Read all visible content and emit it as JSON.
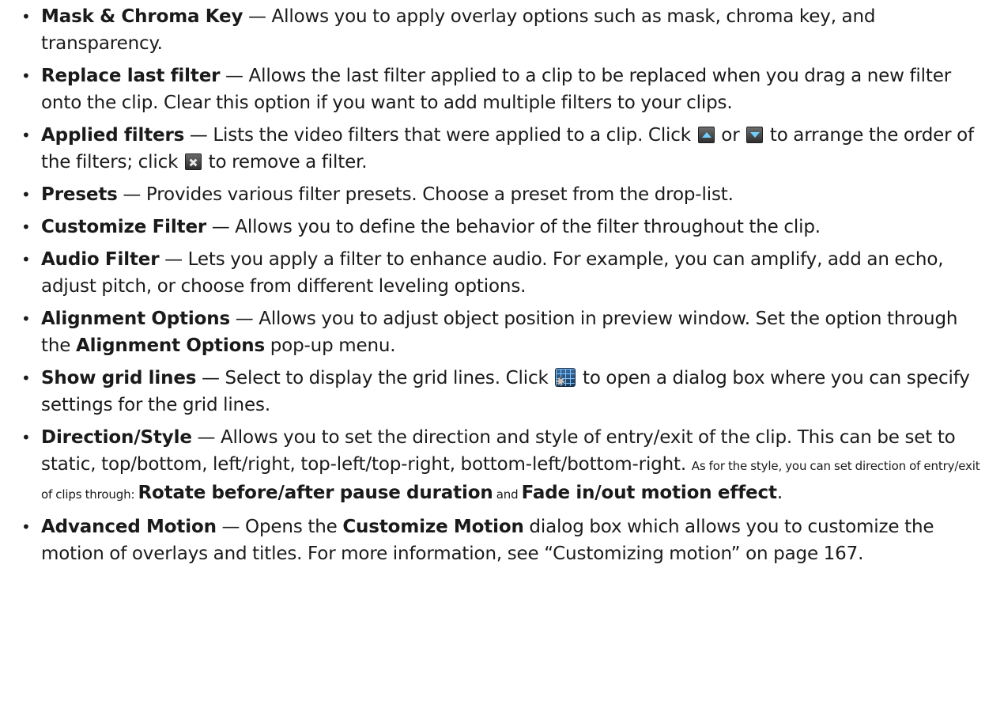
{
  "items": [
    {
      "term": "Mask & Chroma Key",
      "desc": " — Allows you to apply overlay options such as mask, chroma key, and transparency."
    },
    {
      "term": "Replace last filter",
      "desc": " — Allows the last filter applied to a clip to be replaced when you drag a new filter onto the clip. Clear this option if you want to add multiple filters to your clips."
    },
    {
      "term": "Applied filters",
      "desc_a": " — Lists the video filters that were applied to a clip. Click ",
      "desc_b": " or ",
      "desc_c": " to arrange the order of the filters; click ",
      "desc_d": " to remove a filter."
    },
    {
      "term": "Presets",
      "desc": " — Provides various filter presets. Choose a preset from the drop-list."
    },
    {
      "term": "Customize Filter",
      "desc": " — Allows you to define the behavior of the filter throughout the clip."
    },
    {
      "term": "Audio Filter",
      "desc": " — Lets you apply a filter to enhance audio. For example, you can amplify, add an echo, adjust pitch, or choose from different leveling options."
    },
    {
      "term": "Alignment Options",
      "desc_a": " — Allows you to adjust object position in preview window. Set the option through the ",
      "term_b": "Alignment Options",
      "desc_b": " pop-up menu."
    },
    {
      "term": "Show grid lines",
      "desc_a": " — Select to display the grid lines. Click ",
      "desc_b": " to open a dialog box where you can specify settings for the grid lines."
    },
    {
      "term": "Direction/Style",
      "desc_a": " — Allows you to set the direction and style of entry/exit of the clip. This can be set to static, top/bottom, left/right, top-left/top-right, bottom-left/bottom-right.",
      "small_a": "As for the style, you can set direction of entry/exit of clips through: ",
      "term_b": "Rotate before/after pause duration",
      "small_b": " and ",
      "term_c": "Fade in/out motion effect",
      "desc_end": "."
    },
    {
      "term": "Advanced Motion",
      "desc_a": " — Opens the ",
      "term_b": "Customize Motion",
      "desc_b": " dialog box which allows you to customize the motion of overlays and titles. For more information, see “Customizing motion” on page 167."
    }
  ],
  "icons": {
    "move_up": "move-up-arrow-icon",
    "move_down": "move-down-arrow-icon",
    "remove": "remove-x-icon",
    "grid_settings": "grid-settings-icon"
  }
}
